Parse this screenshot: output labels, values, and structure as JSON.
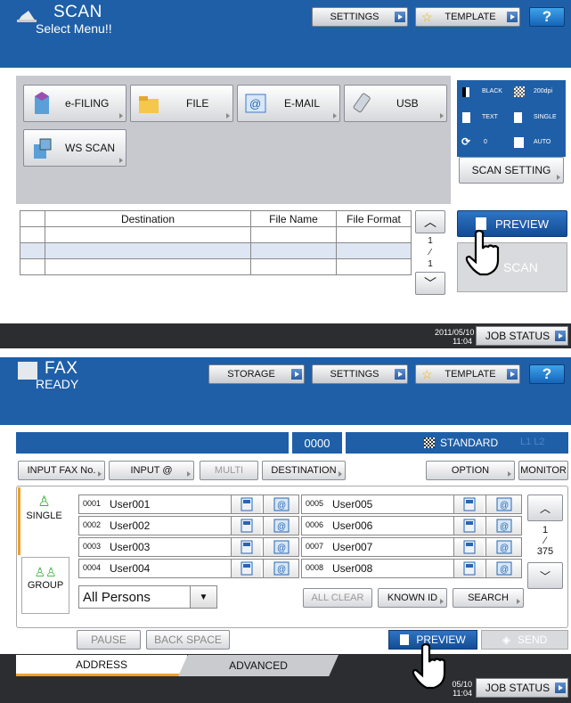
{
  "scan": {
    "title": "SCAN",
    "subtitle": "Select Menu!!",
    "settings": "SETTINGS",
    "template": "TEMPLATE",
    "help": "?",
    "menu": [
      "e-FILING",
      "FILE",
      "E-MAIL",
      "USB",
      "WS SCAN"
    ],
    "status": {
      "color": "BLACK",
      "res": "200dpi",
      "mode": "TEXT",
      "sides": "SINGLE",
      "rotate": "0",
      "size": "AUTO"
    },
    "scan_setting": "SCAN SETTING",
    "table": {
      "headers": [
        "Destination",
        "File Name",
        "File Format"
      ],
      "page": "1",
      "total": "1"
    },
    "preview": "PREVIEW",
    "scan": "SCAN",
    "date": "2011/05/10",
    "time": "11:04",
    "job": "JOB STATUS"
  },
  "fax": {
    "title": "FAX",
    "subtitle": "READY",
    "storage": "STORAGE",
    "settings": "SETTINGS",
    "template": "TEMPLATE",
    "help": "?",
    "counter": "0000",
    "quality": "STANDARD",
    "lines": "L1 L2",
    "buttons": [
      "INPUT FAX No.",
      "INPUT @",
      "MULTI",
      "DESTINATION",
      "OPTION",
      "MONITOR"
    ],
    "tabs": [
      "SINGLE",
      "GROUP"
    ],
    "users_left": [
      [
        "0001",
        "User001"
      ],
      [
        "0002",
        "User002"
      ],
      [
        "0003",
        "User003"
      ],
      [
        "0004",
        "User004"
      ]
    ],
    "users_right": [
      [
        "0005",
        "User005"
      ],
      [
        "0006",
        "User006"
      ],
      [
        "0007",
        "User007"
      ],
      [
        "0008",
        "User008"
      ]
    ],
    "page": "1",
    "total": "375",
    "filter": "All Persons",
    "actions": [
      "ALL CLEAR",
      "KNOWN ID",
      "SEARCH"
    ],
    "bottom": [
      "PAUSE",
      "BACK SPACE",
      "PREVIEW",
      "SEND"
    ],
    "btabs": [
      "ADDRESS",
      "ADVANCED"
    ],
    "date": "05/10",
    "time": "11:04",
    "job": "JOB STATUS"
  }
}
